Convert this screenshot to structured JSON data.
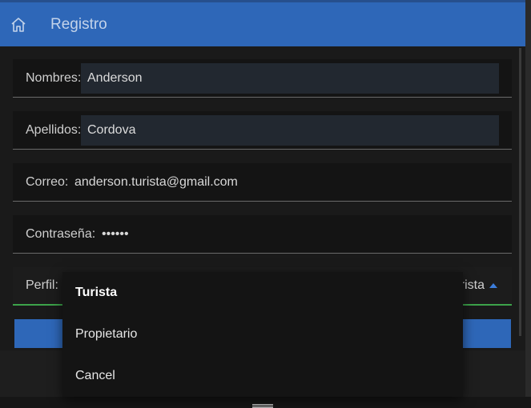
{
  "header": {
    "title": "Registro",
    "home_icon": "home-icon"
  },
  "form": {
    "nombres": {
      "label": "Nombres:",
      "value": "Anderson"
    },
    "apellidos": {
      "label": "Apellidos:",
      "value": "Cordova"
    },
    "correo": {
      "label": "Correo:",
      "value": "anderson.turista@gmail.com"
    },
    "contrasena": {
      "label": "Contraseña:",
      "value": "••••••"
    },
    "perfil": {
      "label": "Perfil:",
      "value": "rista",
      "caret_icon": "caret-up-icon"
    }
  },
  "dropdown": {
    "options": [
      {
        "label": "Turista",
        "selected": true
      },
      {
        "label": "Propietario",
        "selected": false
      },
      {
        "label": "Cancel",
        "selected": false
      }
    ]
  },
  "colors": {
    "accent": "#2e67b8",
    "valid_underline": "#3ca34a",
    "background": "#1a1a1a"
  }
}
